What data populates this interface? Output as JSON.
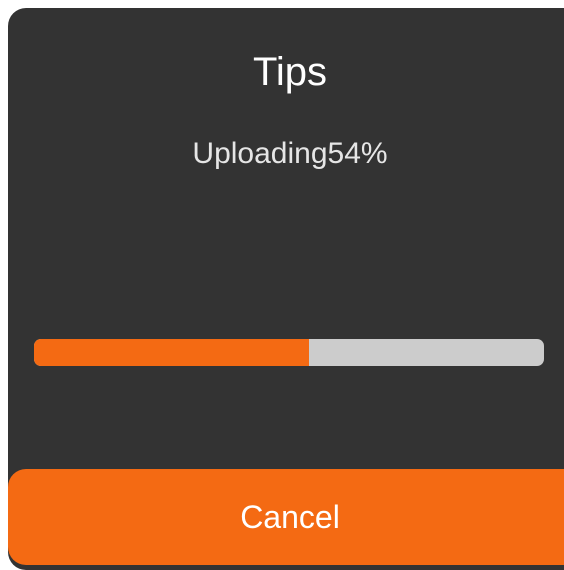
{
  "dialog": {
    "title": "Tips",
    "message": "Uploading54%",
    "progress": 0.54,
    "cancel_label": "Cancel"
  },
  "colors": {
    "dialog_background": "#333333",
    "accent": "#f46a13",
    "track": "#cccccc",
    "text": "#ffffff"
  }
}
